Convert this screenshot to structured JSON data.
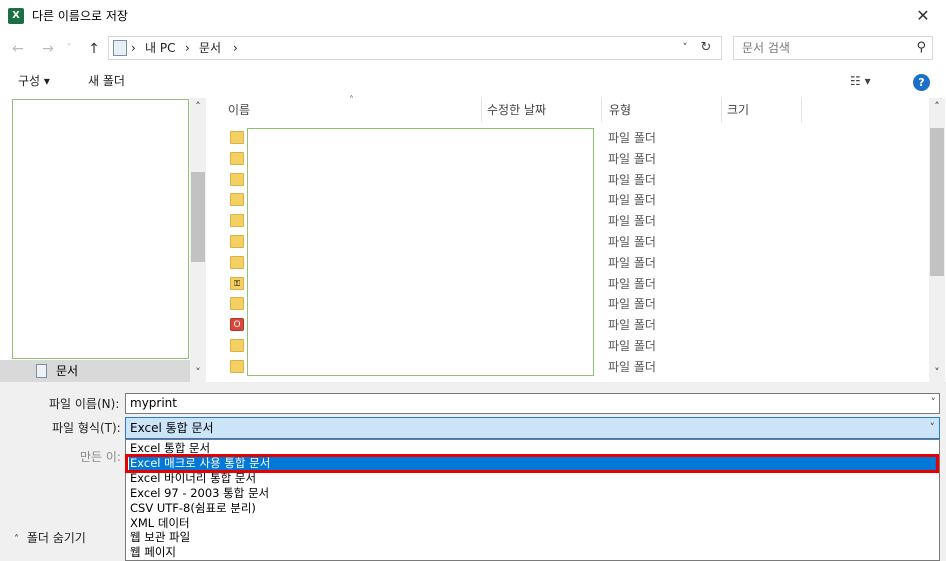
{
  "window": {
    "title": "다른 이름으로 저장",
    "app_icon": "X"
  },
  "nav": {
    "back": "←",
    "forward": "→",
    "recent": "˅",
    "up": "↑",
    "sep1": "›",
    "sep2": "›",
    "sep3": "›",
    "crumbs": [
      "내 PC",
      "문서"
    ],
    "addr_dropdown": "˅",
    "refresh": "↻",
    "search_placeholder": "문서 검색"
  },
  "toolbar": {
    "organize": "구성 ▾",
    "new_folder": "새 폴더",
    "view": "☷ ▾",
    "help": "?"
  },
  "nav_pane": {
    "selected": "문서",
    "scroll_up": "˄",
    "scroll_down": "˅"
  },
  "columns": {
    "name": "이름",
    "date": "수정한 날짜",
    "type": "유형",
    "size": "크기",
    "sort_arrow": "˄"
  },
  "files": [
    {
      "type": "파일 폴더",
      "icon": "folder"
    },
    {
      "type": "파일 폴더",
      "icon": "folder"
    },
    {
      "type": "파일 폴더",
      "icon": "folder"
    },
    {
      "type": "파일 폴더",
      "icon": "folder"
    },
    {
      "type": "파일 폴더",
      "icon": "folder"
    },
    {
      "type": "파일 폴더",
      "icon": "folder"
    },
    {
      "type": "파일 폴더",
      "icon": "folder"
    },
    {
      "type": "파일 폴더",
      "icon": "key-folder"
    },
    {
      "type": "파일 폴더",
      "icon": "folder"
    },
    {
      "type": "파일 폴더",
      "icon": "office-folder"
    },
    {
      "type": "파일 폴더",
      "icon": "folder"
    },
    {
      "type": "파일 폴더",
      "icon": "folder"
    }
  ],
  "form": {
    "filename_label": "파일 이름(N):",
    "filename_value": "myprint",
    "filetype_label": "파일 형식(T):",
    "filetype_value": "Excel 통합 문서",
    "author_label": "만든 이:",
    "hide_folders": "폴더 숨기기",
    "dd_arrow": "˅"
  },
  "filetype_options": [
    "Excel 통합 문서",
    "Excel 매크로 사용 통합 문서",
    "Excel 바이너리 통합 문서",
    "Excel 97 - 2003 통합 문서",
    "CSV UTF-8(쉼표로 분리)",
    "XML 데이터",
    "웹 보관 파일",
    "웹 페이지"
  ],
  "selected_option_index": 1,
  "colors": {
    "accent": "#0078d7",
    "highlight": "#e60000",
    "excel": "#1d6f42"
  }
}
